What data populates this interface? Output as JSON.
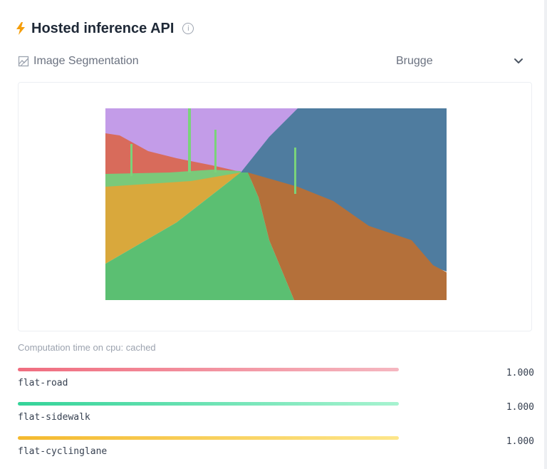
{
  "header": {
    "title": "Hosted inference API",
    "info_icon": "info-icon",
    "icon": "lightning-bolt-icon",
    "icon_color": "#f59e0b"
  },
  "task": {
    "label": "Image Segmentation",
    "icon": "image-segmentation-icon"
  },
  "model_select": {
    "value": "Brugge",
    "icon": "chevron-down-icon"
  },
  "computation": {
    "text": "Computation time on cpu: cached"
  },
  "labels": [
    {
      "name": "flat-road",
      "score": "1.000",
      "color_start": "#f87171",
      "color_end": "#fecaca",
      "fill": 1.0
    },
    {
      "name": "flat-sidewalk",
      "score": "1.000",
      "color_start": "#34d399",
      "color_end": "#a7f3d0",
      "fill": 1.0
    },
    {
      "name": "flat-cyclinglane",
      "score": "1.000",
      "color_start": "#fbbf24",
      "color_end": "#fde68a",
      "fill": 1.0
    }
  ]
}
